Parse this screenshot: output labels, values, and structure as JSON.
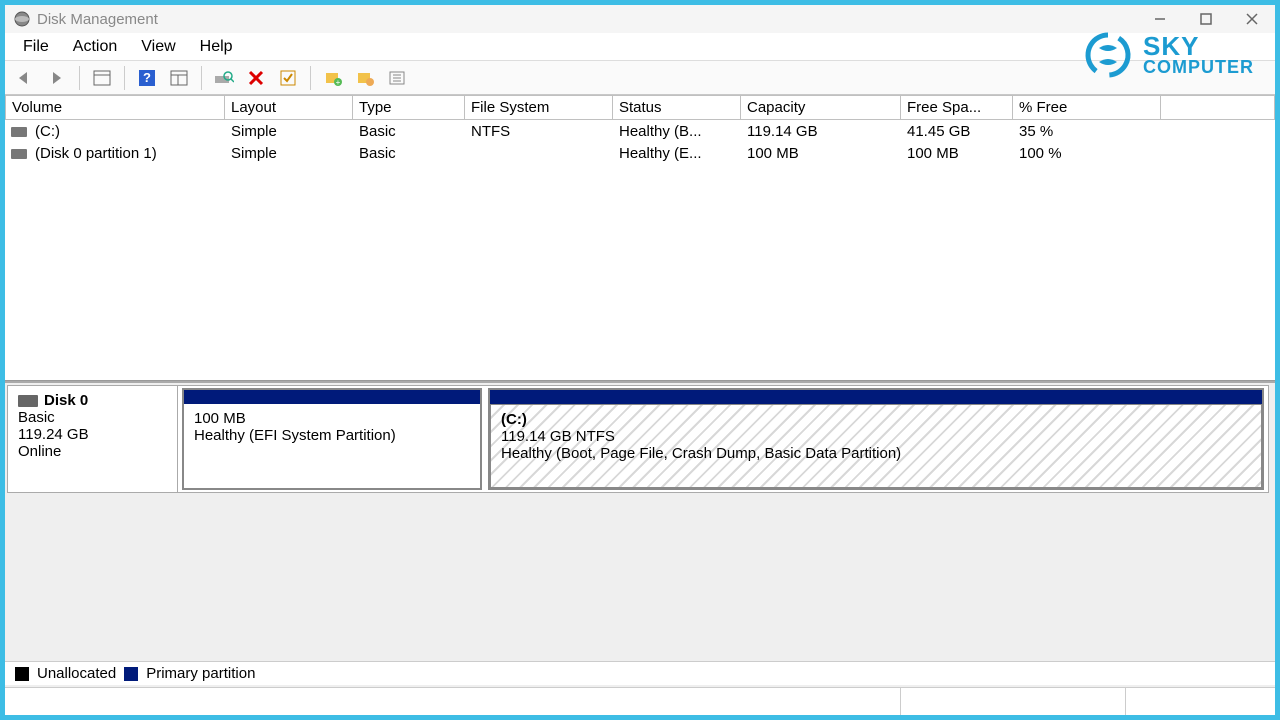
{
  "window": {
    "title": "Disk Management"
  },
  "menu": {
    "file": "File",
    "action": "Action",
    "view": "View",
    "help": "Help"
  },
  "logo": {
    "line1": "SKY",
    "line2": "COMPUTER"
  },
  "columns": {
    "volume": "Volume",
    "layout": "Layout",
    "type": "Type",
    "filesystem": "File System",
    "status": "Status",
    "capacity": "Capacity",
    "freespace": "Free Spa...",
    "pctfree": "% Free"
  },
  "rows": [
    {
      "volume": "(C:)",
      "layout": "Simple",
      "type": "Basic",
      "fs": "NTFS",
      "status": "Healthy (B...",
      "capacity": "119.14 GB",
      "free": "41.45 GB",
      "pct": "35 %"
    },
    {
      "volume": "(Disk 0 partition 1)",
      "layout": "Simple",
      "type": "Basic",
      "fs": "",
      "status": "Healthy (E...",
      "capacity": "100 MB",
      "free": "100 MB",
      "pct": "100 %"
    }
  ],
  "disk": {
    "name": "Disk 0",
    "type": "Basic",
    "size": "119.24 GB",
    "state": "Online",
    "parts": [
      {
        "title": "",
        "line2": "100 MB",
        "line3": "Healthy (EFI System Partition)"
      },
      {
        "title": "(C:)",
        "line2": "119.14 GB NTFS",
        "line3": "Healthy (Boot, Page File, Crash Dump, Basic Data Partition)"
      }
    ]
  },
  "legend": {
    "unallocated": "Unallocated",
    "primary": "Primary partition"
  }
}
